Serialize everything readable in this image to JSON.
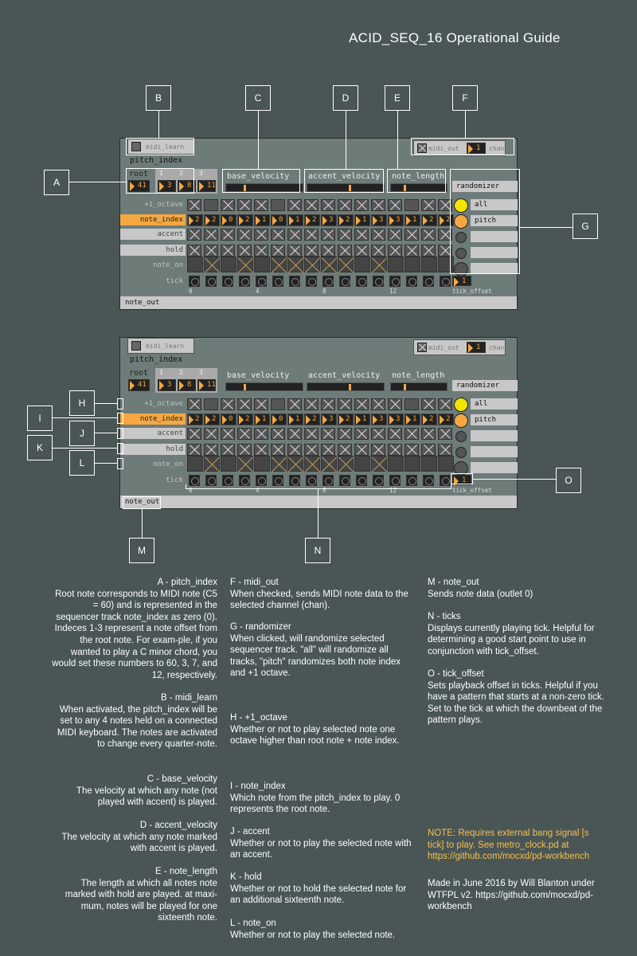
{
  "title": "ACID_SEQ_16  Operational  Guide",
  "panel": {
    "midi_learn": "midi_learn",
    "pitch_index": "pitch_index",
    "root": "root",
    "root_val": "41",
    "pi_idx": [
      "1",
      "2",
      "3"
    ],
    "pi_vals": [
      "3",
      "8",
      "11"
    ],
    "base_velocity": "base_velocity",
    "accent_velocity": "accent_velocity",
    "note_length": "note_length",
    "midi_out": "midi_out",
    "chan_val": "1",
    "chan": "chan",
    "randomizer": "randomizer",
    "all": "all",
    "pitch": "pitch",
    "rows": {
      "octave": "+1_octave",
      "note_index": "note_index",
      "accent": "accent",
      "hold": "hold",
      "note_on": "note_on",
      "tick": "tick"
    },
    "note_vals": [
      "2",
      "2",
      "0",
      "2",
      "1",
      "0",
      "1",
      "2",
      "3",
      "2",
      "1",
      "3",
      "3",
      "1",
      "2",
      "2"
    ],
    "octave_on": [
      1,
      0,
      1,
      1,
      1,
      0,
      1,
      1,
      1,
      1,
      1,
      1,
      1,
      0,
      1,
      1
    ],
    "accent_on": [
      1,
      1,
      1,
      1,
      1,
      1,
      1,
      1,
      1,
      1,
      1,
      1,
      1,
      1,
      1,
      1
    ],
    "hold_on": [
      1,
      1,
      1,
      1,
      1,
      1,
      1,
      1,
      1,
      1,
      1,
      1,
      1,
      1,
      1,
      1
    ],
    "noteon_on": [
      0,
      1,
      0,
      1,
      0,
      1,
      1,
      1,
      1,
      1,
      0,
      1,
      0,
      0,
      0,
      0
    ],
    "tick_labels": [
      "0",
      "4",
      "8",
      "12"
    ],
    "tick_offset_val": "1",
    "tick_offset": "tick_offset",
    "note_out": "note_out"
  },
  "tags": [
    "A",
    "B",
    "C",
    "D",
    "E",
    "F",
    "G",
    "H",
    "I",
    "J",
    "K",
    "L",
    "M",
    "N",
    "O"
  ],
  "desc": {
    "colA": [
      {
        "h": "A - pitch_index",
        "t": "Root note corresponds to MIDI note (C5 = 60) and is represented in the sequencer track note_index as zero (0). Indeces 1-3 represent a note offset from the root note. For exam-ple, if you wanted to play a C minor chord, you would set these numbers to 60, 3, 7, and 12, respectively."
      },
      {
        "h": "B - midi_learn",
        "t": "When activated, the pitch_index will be set to any 4 notes held on a connected MIDI keyboard. The notes are activated to change every quarter-note."
      },
      {
        "h": "C - base_velocity",
        "t": "The velocity at which any note (not played with accent) is played."
      },
      {
        "h": "D - accent_velocity",
        "t": "The velocity at which any note marked with accent is played."
      },
      {
        "h": "E - note_length",
        "t": "The length at which all notes note marked with hold are played. at maxi-mum, notes will be played for one sixteenth note."
      }
    ],
    "colB": [
      {
        "h": "F - midi_out",
        "t": "When checked, sends MIDI note data to the selected channel (chan)."
      },
      {
        "h": "G - randomizer",
        "t": "When clicked, will randomize selected sequencer track. \"all\" will randomize all tracks, \"pitch\" randomizes both note index and +1 octave."
      },
      {
        "h": "H - +1_octave",
        "t": "Whether or not to play selected note one octave higher than root note + note index."
      },
      {
        "h": "I - note_index",
        "t": "Which note from the pitch_index to play. 0 represents the root note."
      },
      {
        "h": "J - accent",
        "t": "Whether or not to play the selected note with an accent."
      },
      {
        "h": "K - hold",
        "t": "Whether or not to hold the selected note for an additional sixteenth note."
      },
      {
        "h": "L - note_on",
        "t": "Whether or not to play the selected note."
      }
    ],
    "colC": [
      {
        "h": "M - note_out",
        "t": "Sends note data (outlet 0)"
      },
      {
        "h": "N - ticks",
        "t": "Displays currently playing tick. Helpful for determining a good start point to use in conjunction with tick_offset."
      },
      {
        "h": "O - tick_offset",
        "t": "Sets playback offset in ticks. Helpful if you have a pattern that starts at a non-zero tick. Set to the tick at which the downbeat of the pattern plays."
      }
    ],
    "note": "NOTE: Requires external bang signal [s tick] to play. See metro_clock.pd at https://github.com/mocxd/pd-workbench",
    "credit": "Made in June 2016 by Will Blanton under WTFPL v2. https://github.com/mocxd/pd-workbench"
  },
  "colors": {
    "bg": "#4a5555",
    "panel": "#6e7c79",
    "accent": "#f5a842",
    "bang": "#f2e600"
  }
}
